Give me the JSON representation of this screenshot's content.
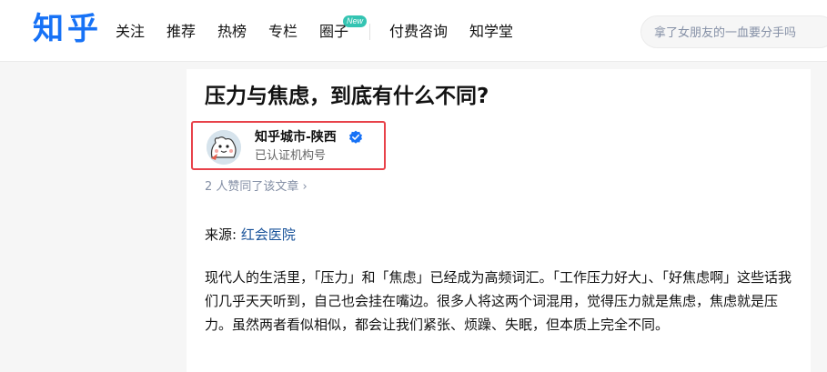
{
  "header": {
    "logo": "知乎",
    "nav": [
      {
        "label": "关注"
      },
      {
        "label": "推荐"
      },
      {
        "label": "热榜"
      },
      {
        "label": "专栏"
      },
      {
        "label": "圈子",
        "badge": "New"
      },
      {
        "label": "付费咨询"
      },
      {
        "label": "知学堂"
      }
    ],
    "search": {
      "placeholder": "拿了女朋友的一血要分手吗"
    }
  },
  "article": {
    "title": "压力与焦虑，到底有什么不同?",
    "author": {
      "name": "知乎城市-陕西",
      "description": "已认证机构号",
      "verified_icon": "verified-check-icon"
    },
    "likes": "2 人赞同了该文章",
    "likes_chevron": "›",
    "source": {
      "label": "来源:",
      "link": "红会医院"
    },
    "paragraph": "现代人的生活里，「压力」和「焦虑」已经成为高频词汇。「工作压力好大」、「好焦虑啊」这些话我们几乎天天听到，自己也会挂在嘴边。很多人将这两个词混用，觉得压力就是焦虑，焦虑就是压力。虽然两者看似相似，都会让我们紧张、烦躁、失眠，但本质上完全不同。"
  },
  "colors": {
    "brand": "#1772f6",
    "highlight_border": "#e8424a",
    "badge": "#34c4b2",
    "link": "#175199"
  }
}
